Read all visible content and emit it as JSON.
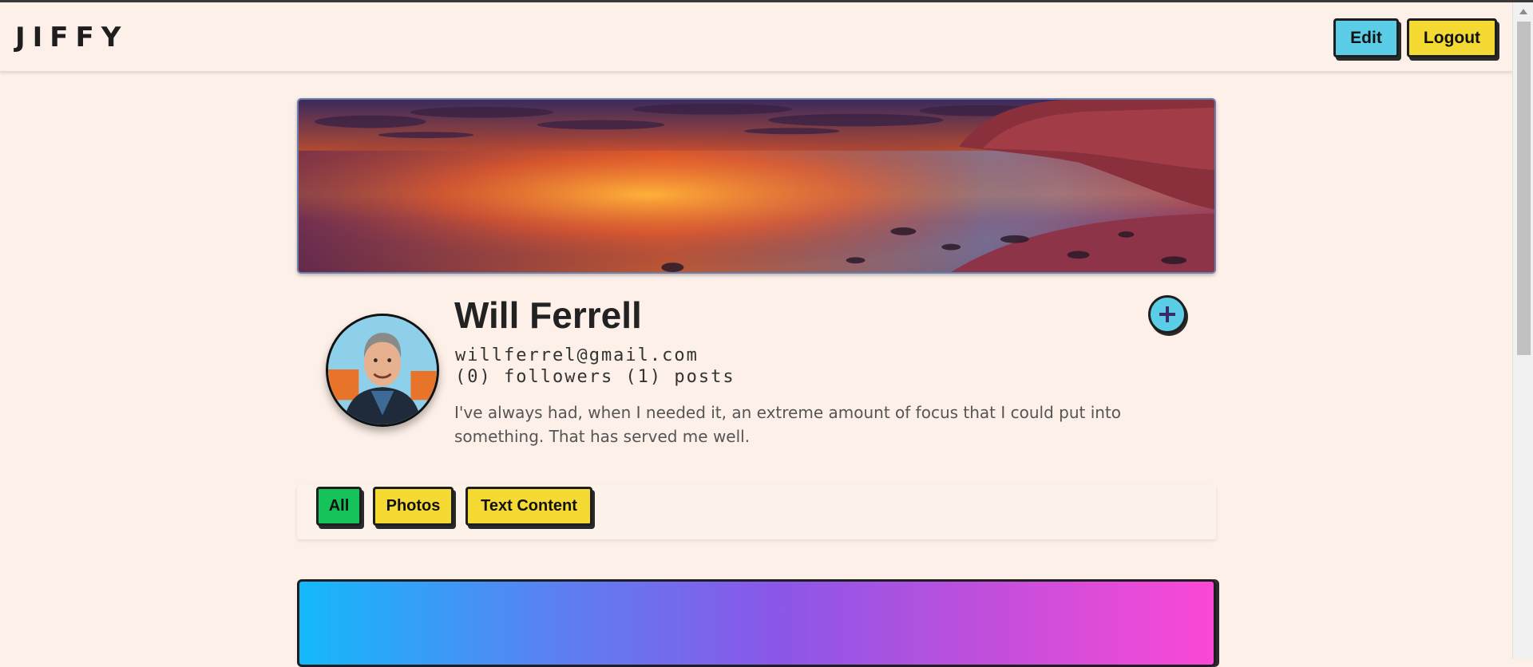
{
  "app": {
    "logo": "JIFFY"
  },
  "header": {
    "edit_label": "Edit",
    "logout_label": "Logout",
    "accent_edit": "#5bcde6",
    "accent_logout": "#f5da34"
  },
  "profile": {
    "name": "Will Ferrell",
    "email": "willferrel@gmail.com",
    "stats": "(0) followers (1) posts",
    "bio": "I've always had, when I needed it, an extreme amount of focus that I could put into something. That has served me well.",
    "add_icon": "plus-icon"
  },
  "filters": {
    "items": [
      {
        "label": "All",
        "active": true,
        "color": "#16c35a"
      },
      {
        "label": "Photos",
        "active": false,
        "color": "#f5da34"
      },
      {
        "label": "Text Content",
        "active": false,
        "color": "#f5da34"
      }
    ]
  }
}
